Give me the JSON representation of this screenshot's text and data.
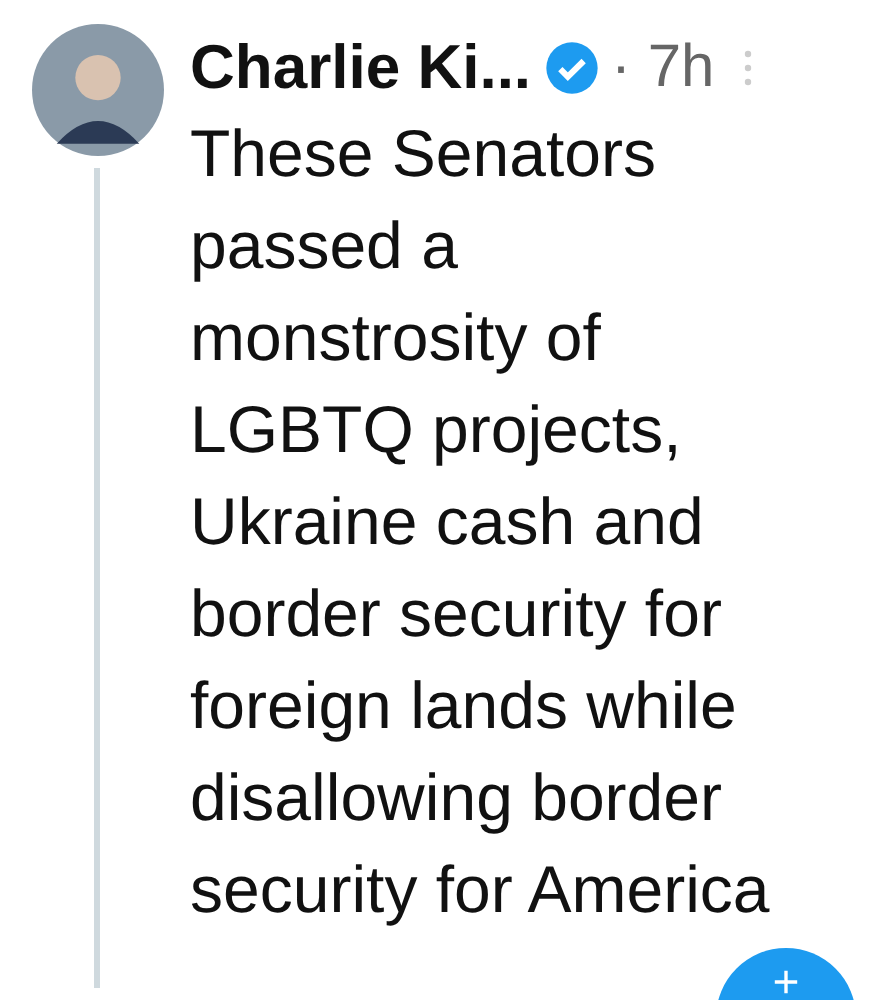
{
  "tweet": {
    "author": "Charlie Ki...",
    "verified": true,
    "time": "· 7h",
    "text": "These Senators\npassed a\nmonstrosity of\nLGBTQ projects,\nUkraine cash and\nborder security for\nforeign lands while\ndisallowing border\nsecurity for America"
  }
}
